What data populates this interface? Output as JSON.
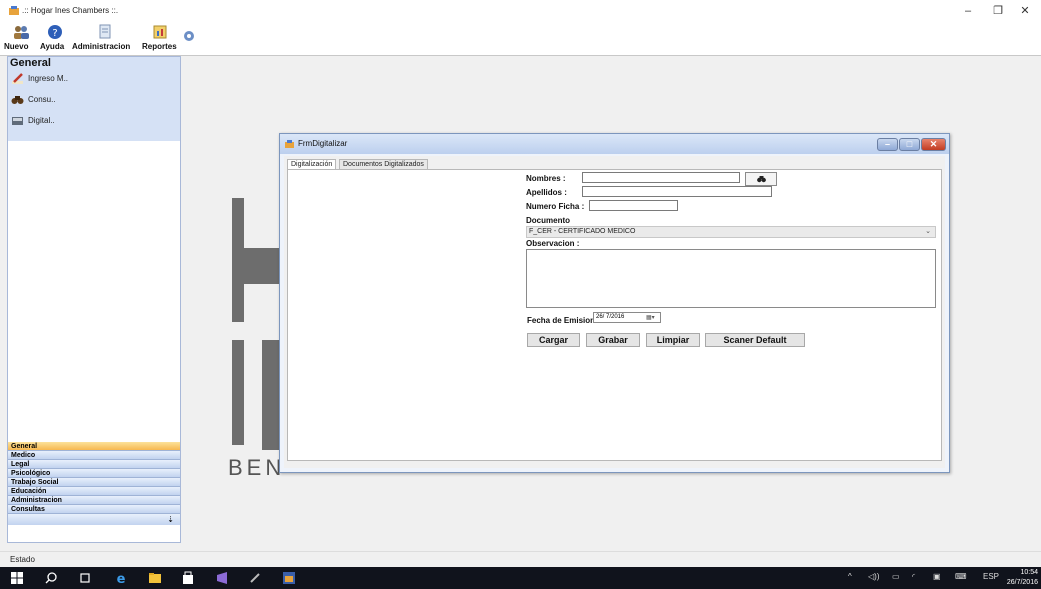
{
  "window": {
    "title": ".:: Hogar Ines Chambers ::."
  },
  "toolbar": {
    "nuevo": "Nuevo",
    "ayuda": "Ayuda",
    "administracion": "Administracion",
    "reportes": "Reportes"
  },
  "nav": {
    "header": "General",
    "items": [
      {
        "label": "Ingreso M..",
        "icon": "pencil-icon"
      },
      {
        "label": "Consu..",
        "icon": "binoculars-icon"
      },
      {
        "label": "Digital..",
        "icon": "scanner-icon"
      }
    ],
    "categories": [
      "General",
      "Medico",
      "Legal",
      "Psicológico",
      "Trabajo Social",
      "Educación",
      "Administracion",
      "Consultas"
    ],
    "active_category": "General"
  },
  "background": {
    "logo_text": "BEN"
  },
  "form": {
    "title": "FrmDigitalizar",
    "tabs": [
      "Digitalización",
      "Documentos Digitalizados"
    ],
    "fields": {
      "nombres_label": "Nombres :",
      "nombres_value": "",
      "apellidos_label": "Apellidos :",
      "apellidos_value": "",
      "numero_ficha_label": "Numero Ficha :",
      "numero_ficha_value": "",
      "documento_label": "Documento",
      "documento_value": "F_CER - CERTIFICADO MEDICO",
      "observacion_label": "Observacion :",
      "observacion_value": "",
      "fecha_label": "Fecha de Emision:",
      "fecha_value": "26/ 7/2016"
    },
    "buttons": {
      "cargar": "Cargar",
      "grabar": "Grabar",
      "limpiar": "Limpiar",
      "scaner": "Scaner Default"
    }
  },
  "statusbar": {
    "text": "Estado"
  },
  "taskbar": {
    "language": "ESP",
    "time": "10:54",
    "date": "26/7/2016"
  },
  "colors": {
    "nav_active": "#f7b850",
    "nav_bg": "#d5e1f5",
    "close_button": "#c23c22",
    "taskbar": "#10131c"
  }
}
